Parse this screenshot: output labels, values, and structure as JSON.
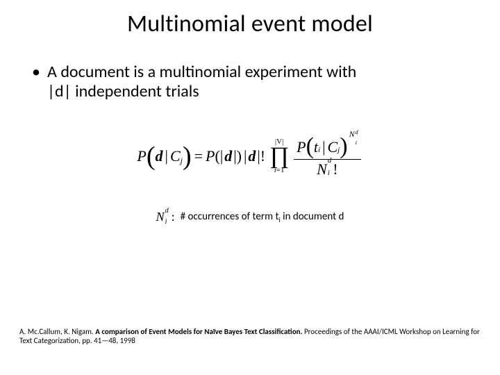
{
  "title": "Multinomial event model",
  "bullet": {
    "marker": "•",
    "line1": "A document is a multinomial experiment with",
    "line2": "|d| independent trials"
  },
  "formula": {
    "lhs": {
      "P": "P",
      "d": "d",
      "bar": "|",
      "C": "C",
      "j": "j"
    },
    "eq": "=",
    "plen": {
      "P": "P",
      "open": "(|",
      "d": "d",
      "close": "|)"
    },
    "fact": {
      "open": "|",
      "d": "d",
      "close": "|",
      "bang": "!"
    },
    "prod": {
      "sym": "∏",
      "top": "|V|",
      "bot_left": "i",
      "bot_eq": "=1"
    },
    "frac": {
      "num": {
        "P": "P",
        "t": "t",
        "i": "i",
        "bar": "|",
        "C": "C",
        "j": "j",
        "exp_N": "N",
        "exp_sup": "d",
        "exp_sub": "i"
      },
      "den": {
        "N": "N",
        "sup": "d",
        "sub": "i",
        "bang": "!"
      }
    }
  },
  "legend": {
    "sym": {
      "N": "N",
      "sup": "d",
      "sub": "i",
      "colon": ":"
    },
    "text_before": "# occurrences of term t",
    "text_sub": "i",
    "text_after": " in document d"
  },
  "citation": {
    "authors": "A. Mc.Callum, K. Nigam. ",
    "title": "A comparison of Event Models for Naïve Bayes Text Classification.",
    "rest": " Proceedings of the AAAI/ICML Workshop on Learning for Text Categorization, pp. 41—48, 1998"
  }
}
